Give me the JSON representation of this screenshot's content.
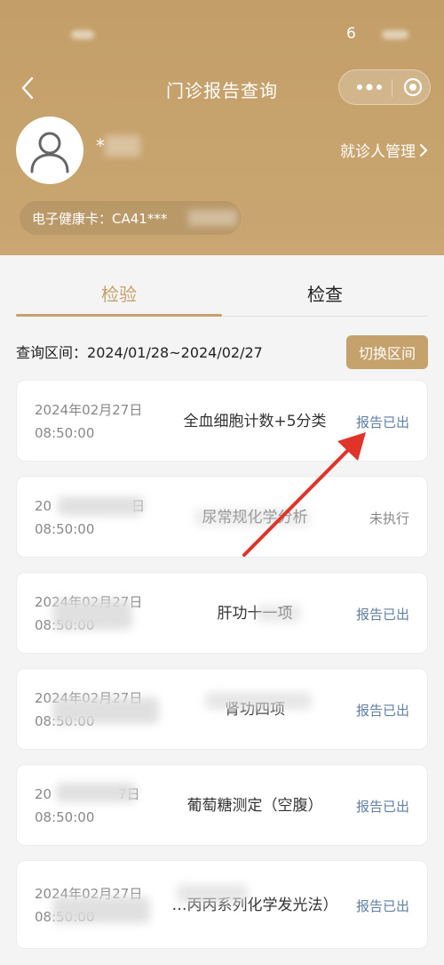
{
  "status_bar": {
    "signal_text": "6"
  },
  "nav": {
    "title": "门诊报告查询",
    "back_icon": "chevron-left-icon",
    "more_icon": "more-dots-icon",
    "close_icon": "target-close-icon"
  },
  "profile": {
    "name": "*",
    "manage_label": "就诊人管理",
    "card_label": "电子健康卡：CA41***"
  },
  "tabs": [
    {
      "label": "检验"
    },
    {
      "label": "检查"
    }
  ],
  "range": {
    "label": "查询区间：",
    "value": "2024/01/28~2024/02/27",
    "switch_label": "切换区间"
  },
  "reports": [
    {
      "date": "2024年02月27日",
      "time": "08:50:00",
      "name": "全血细胞计数+5分类",
      "status": "报告已出",
      "status_type": "done"
    },
    {
      "date": "20　　　　　　日",
      "time": "08:50:00",
      "name": "尿常规化学分析",
      "status": "未执行",
      "status_type": "pending"
    },
    {
      "date": "2024年02月27日",
      "time": "08:50:00",
      "name": "肝功十一项",
      "status": "报告已出",
      "status_type": "done"
    },
    {
      "date": "2024年02月27日",
      "time": "08:50:00",
      "name": "肾功四项",
      "status": "报告已出",
      "status_type": "done"
    },
    {
      "date": "20　　　　　7日",
      "time": "08:50:00",
      "name": "葡萄糖测定（空腹）",
      "status": "报告已出",
      "status_type": "done"
    },
    {
      "date": "2024年02月27日",
      "time": "08:50:00",
      "name": "…丙丙系列化学发光法）",
      "status": "报告已出",
      "status_type": "done"
    }
  ],
  "colors": {
    "brand": "#c5a26c",
    "status_done": "#5f7fa6",
    "annotation_arrow": "#e0342b"
  }
}
